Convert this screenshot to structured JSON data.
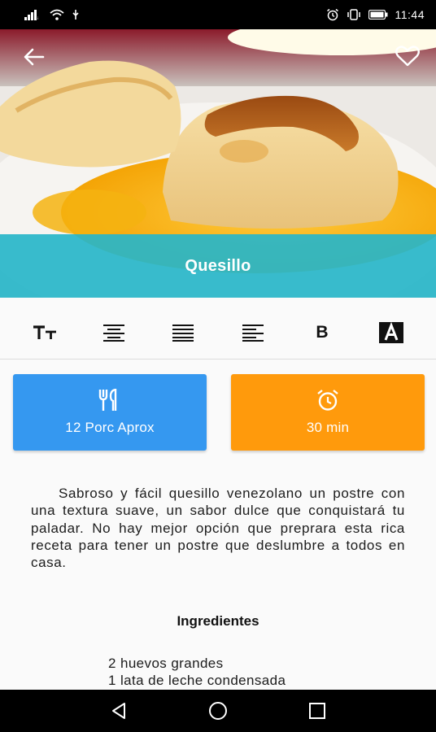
{
  "status_bar": {
    "time": "11:44"
  },
  "recipe": {
    "title": "Quesillo",
    "description": "Sabroso y fácil quesillo venezolano un postre con una textura suave, un sabor dulce que conquistará tu paladar. No hay mejor opción que preprara esta rica receta para tener un postre que deslumbre a todos en casa.",
    "servings_label": "12 Porc Aprox",
    "time_label": "30 min",
    "ingredients_title": "Ingredientes",
    "ingredients": [
      "2 huevos grandes",
      "1 lata de leche condensada"
    ]
  },
  "toolbar": {
    "tools": [
      {
        "name": "text-size-icon",
        "glyph": "Tт"
      },
      {
        "name": "align-center-icon",
        "glyph": ""
      },
      {
        "name": "align-justify-icon",
        "glyph": ""
      },
      {
        "name": "align-left-icon",
        "glyph": ""
      },
      {
        "name": "bold-icon",
        "glyph": "B"
      },
      {
        "name": "highlight-text-icon",
        "glyph": "A"
      }
    ]
  },
  "colors": {
    "title_band": "#29bacc",
    "servings_card": "#3598f0",
    "time_card": "#ff9a0c",
    "status_bar": "#000000"
  }
}
